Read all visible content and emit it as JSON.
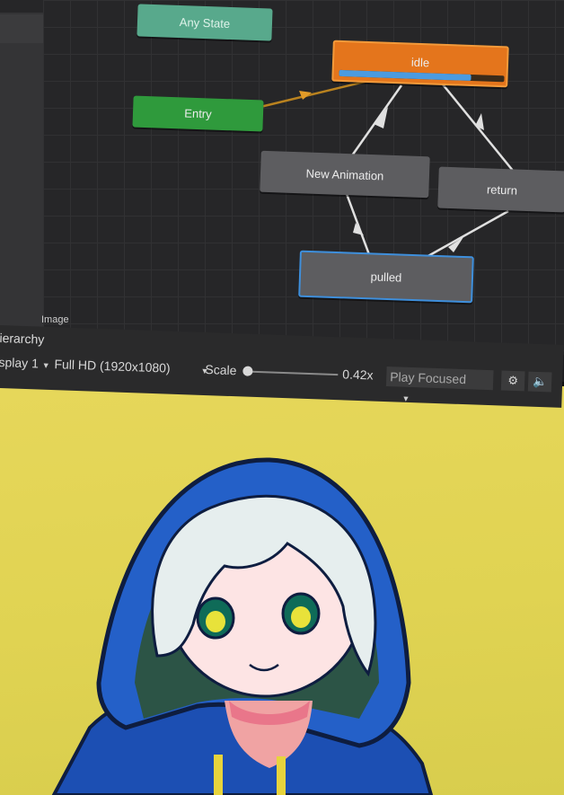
{
  "animator": {
    "panel_label": "Image",
    "states": {
      "any_state": "Any State",
      "entry": "Entry",
      "idle": "idle",
      "new_animation": "New Animation",
      "return": "return",
      "pulled": "pulled"
    },
    "idle_progress_fraction": 0.8,
    "colors": {
      "entry": "#2f9a3c",
      "any_state": "#58a98c",
      "default_state": "#e4751c",
      "state": "#5d5d60",
      "selected_outline": "#3e8fdc"
    }
  },
  "game_view": {
    "hierarchy_label": "ierarchy",
    "display_label": "splay 1",
    "resolution_label": "Full HD (1920x1080)",
    "scale_label": "Scale",
    "scale_value": "0.42x",
    "play_mode_label": "Play Focused",
    "icons": [
      "bug-icon",
      "speaker-icon",
      "stats-icon"
    ],
    "background_color": "#e0d352"
  }
}
